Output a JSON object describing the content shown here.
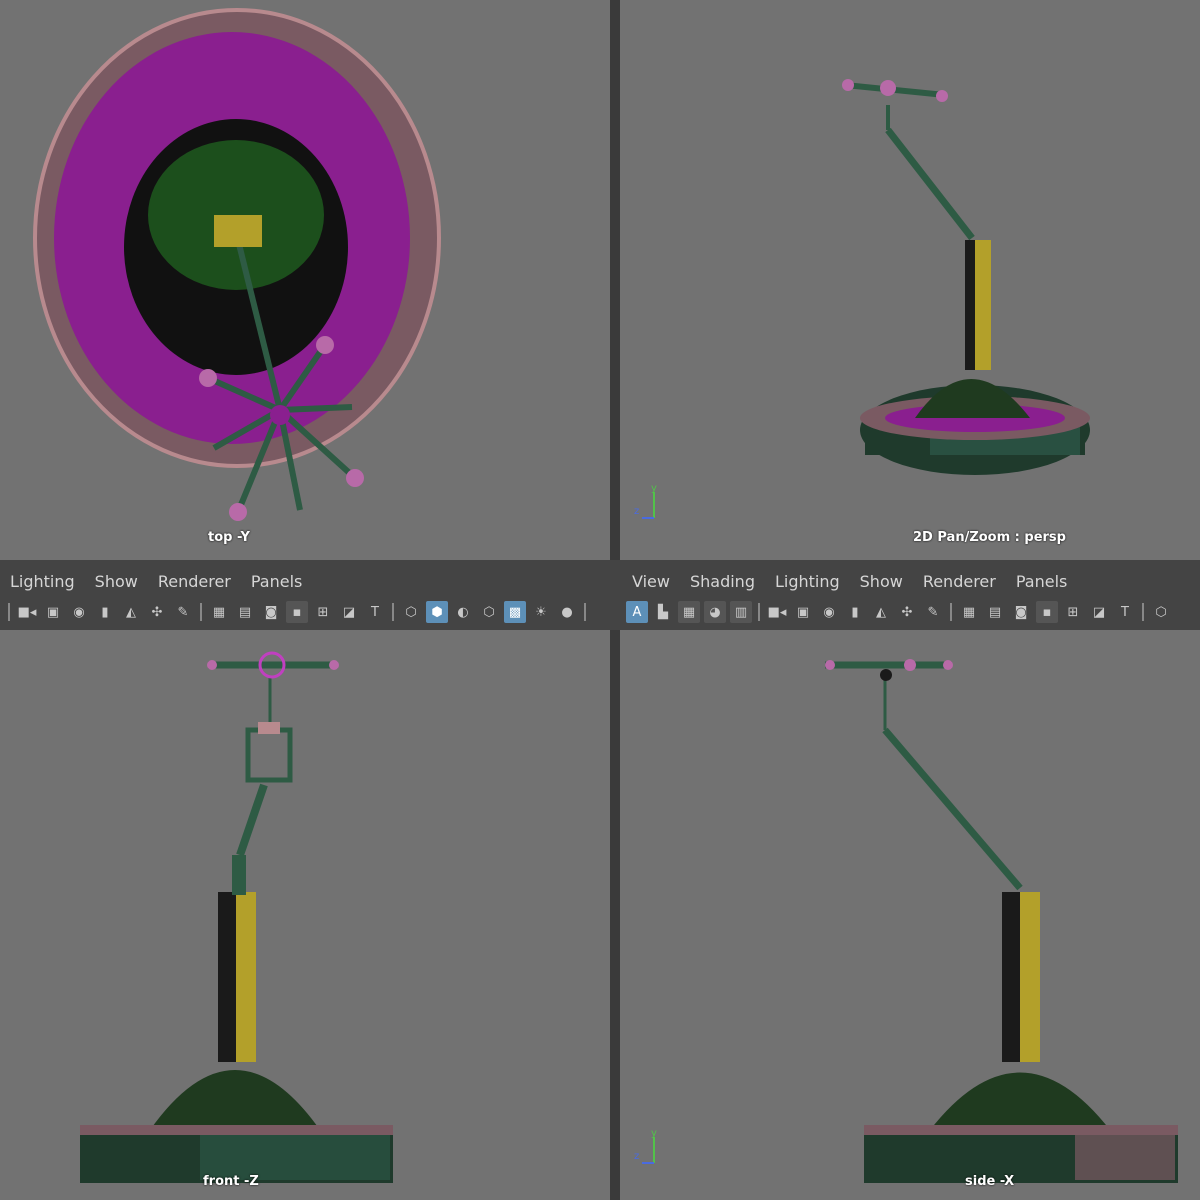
{
  "viewports": {
    "top": {
      "label": "top -Y"
    },
    "persp": {
      "label": "2D Pan/Zoom : persp"
    },
    "front": {
      "label": "front -Z"
    },
    "side": {
      "label": "side -X"
    }
  },
  "left_panel_menu": [
    "Lighting",
    "Show",
    "Renderer",
    "Panels"
  ],
  "right_panel_menu": [
    "View",
    "Shading",
    "Lighting",
    "Show",
    "Renderer",
    "Panels"
  ],
  "axis": {
    "y": "y",
    "z": "z"
  },
  "colors": {
    "viewport_bg": "#727272",
    "toolbar_bg": "#444444",
    "accent": "#5d90b8",
    "base_green": "#1f3a2c",
    "magenta": "#8a1f8f",
    "pink": "#b88a8e",
    "yellow": "#b3a02a"
  },
  "icons_left": [
    "camera-icon",
    "camera-lock-icon",
    "camera-attr-icon",
    "bookmark-icon",
    "select-icon",
    "move-icon",
    "pencil-icon",
    "grid-icon",
    "film-gate-icon",
    "resolution-gate-icon",
    "gate-mask-icon",
    "field-chart-icon",
    "safe-action-icon",
    "safe-title-icon",
    "wireframe-icon",
    "smooth-shade-icon",
    "shade-selected-icon",
    "xray-icon",
    "wireframe-shaded-icon",
    "lights-icon",
    "shadows-icon"
  ],
  "icons_right": [
    "isolate-icon",
    "image-plane-icon",
    "texture-icon",
    "sphere-icon",
    "camera-icon",
    "camera-lock-icon",
    "camera-attr-icon",
    "bookmark-icon",
    "select-icon",
    "move-icon",
    "pencil-icon",
    "grid-icon",
    "film-gate-icon",
    "resolution-gate-icon",
    "gate-mask-icon",
    "field-chart-icon",
    "safe-action-icon",
    "safe-title-icon",
    "wireframe-icon"
  ]
}
